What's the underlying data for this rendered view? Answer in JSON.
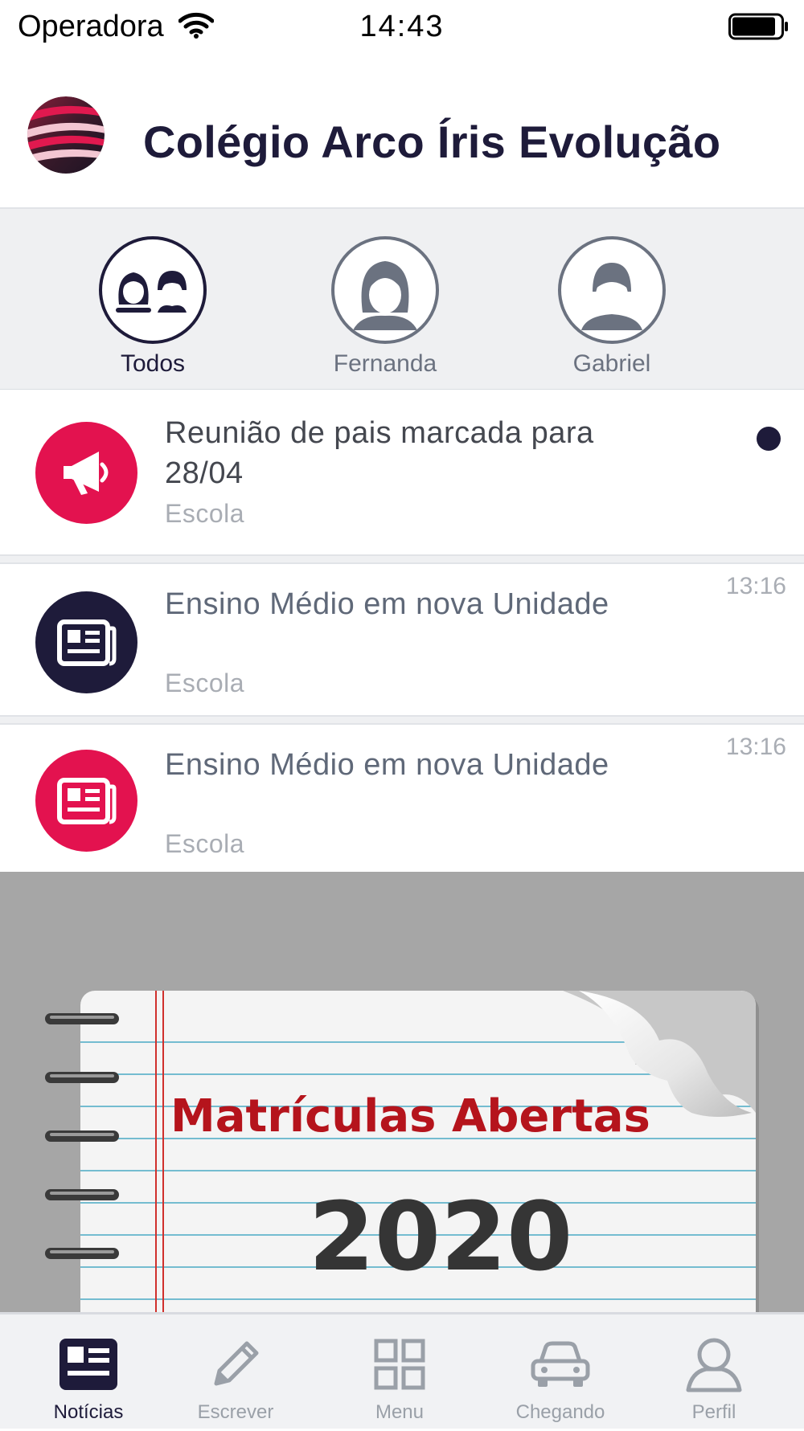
{
  "status_bar": {
    "carrier": "Operadora",
    "time": "14:43"
  },
  "header": {
    "title": "Colégio Arco Íris Evolução"
  },
  "profiles": [
    {
      "label": "Todos",
      "active": true
    },
    {
      "label": "Fernanda",
      "active": false
    },
    {
      "label": "Gabriel",
      "active": false
    }
  ],
  "feed": [
    {
      "title": "Reunião de pais marcada para 28/04",
      "source": "Escola",
      "time": "",
      "unread": true,
      "icon": "megaphone-icon",
      "icon_color": "#e3124f"
    },
    {
      "title": "Ensino Médio em nova Unidade",
      "source": "Escola",
      "time": "13:16",
      "unread": false,
      "icon": "newspaper-icon",
      "icon_color": "#1e1b3a"
    },
    {
      "title": "Ensino Médio em nova Unidade",
      "source": "Escola",
      "time": "13:16",
      "unread": false,
      "icon": "newspaper-icon",
      "icon_color": "#e3124f"
    }
  ],
  "banner": {
    "headline": "Matrículas Abertas",
    "year": "2020"
  },
  "tabs": [
    {
      "label": "Notícias",
      "icon": "news-icon",
      "active": true
    },
    {
      "label": "Escrever",
      "icon": "pencil-icon",
      "active": false
    },
    {
      "label": "Menu",
      "icon": "grid-icon",
      "active": false
    },
    {
      "label": "Chegando",
      "icon": "car-icon",
      "active": false
    },
    {
      "label": "Perfil",
      "icon": "person-icon",
      "active": false
    }
  ],
  "colors": {
    "brand_dark": "#1e1b3a",
    "brand_pink": "#e3124f",
    "muted": "#a9adb4"
  }
}
